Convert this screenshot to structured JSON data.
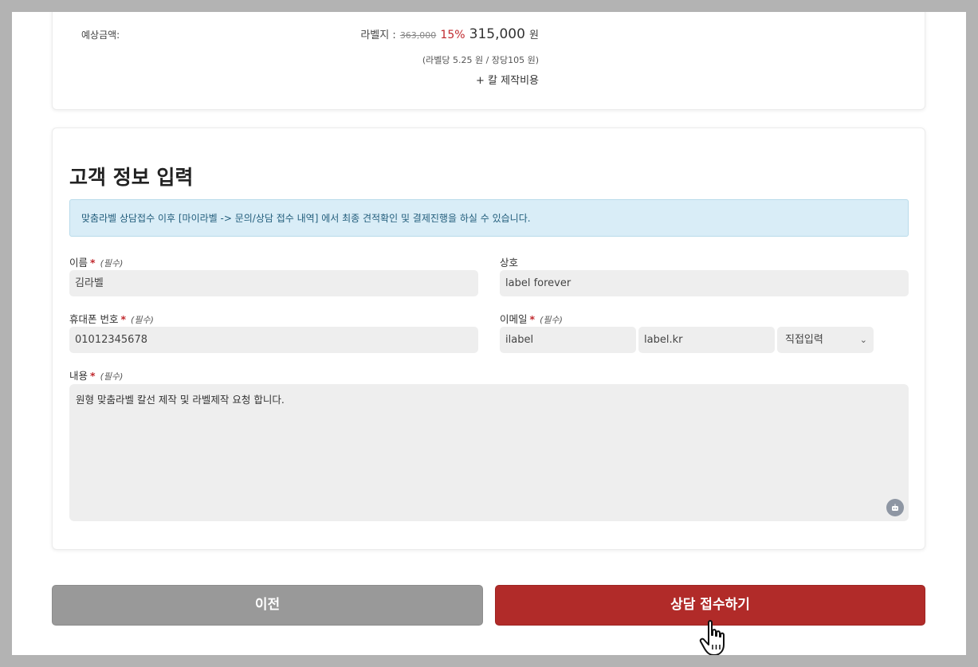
{
  "estimate": {
    "label": "예상금액:",
    "price_prefix": "라벨지 :",
    "original_price": "363,000",
    "discount": "15%",
    "final_price": "315,000",
    "currency": "원",
    "detail": "(라벨당 5.25 원 / 장당105 원)",
    "extra": "+ 칼 제작비용"
  },
  "form": {
    "title": "고객 정보 입력",
    "notice": "맞춤라벨 상담접수 이후 [마이라벨 -> 문의/상담 접수 내역] 에서 최종 견적확인 및 결제진행을 하실 수 있습니다.",
    "required_mark": "*",
    "required_text": "(필수)",
    "name": {
      "label": "이름",
      "value": "김라벨"
    },
    "company": {
      "label": "상호",
      "value": "label forever"
    },
    "phone": {
      "label": "휴대폰 번호",
      "value": "01012345678"
    },
    "email": {
      "label": "이메일",
      "local": "ilabel",
      "domain": "label.kr",
      "domain_select": "직접입력"
    },
    "content": {
      "label": "내용",
      "value": "원형 맞춤라벨 칼선 제작 및 라벨제작 요청 합니다."
    }
  },
  "buttons": {
    "prev": "이전",
    "submit": "상담 접수하기"
  },
  "icons": {
    "textarea_helper": "robot-icon",
    "pointer": "hand-pointer-icon",
    "select_arrow": "chevron-down-icon"
  },
  "colors": {
    "accent_red": "#b12b29",
    "notice_bg": "#d9edf7",
    "prev_button": "#999999"
  }
}
